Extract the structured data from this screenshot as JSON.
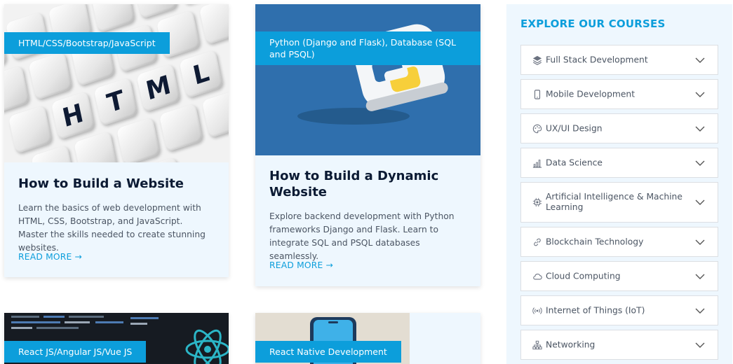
{
  "cards": [
    {
      "tag": "HTML/CSS/Bootstrap/JavaScript",
      "title": "How to Build a Website",
      "description": "Learn the basics of web development with HTML, CSS, Bootstrap, and JavaScript. Master the skills needed to create stunning websites.",
      "more": "READ MORE →",
      "keyboard_letters": [
        "H",
        "T",
        "M",
        "L"
      ]
    },
    {
      "tag": "Python (Django and Flask), Database (SQL and PSQL)",
      "title": "How to Build a Dynamic Website",
      "description": "Explore backend development with Python frameworks Django and Flask. Learn to integrate SQL and PSQL databases seamlessly.",
      "more": "READ MORE →"
    },
    {
      "tag": "React JS/Angular JS/Vue JS"
    },
    {
      "tag": "React Native Development"
    }
  ],
  "sidebar": {
    "title": "EXPLORE OUR COURSES",
    "items": [
      {
        "label": "Full Stack Development",
        "icon": "layers-icon"
      },
      {
        "label": "Mobile Development",
        "icon": "mobile-icon"
      },
      {
        "label": "UX/UI Design",
        "icon": "palette-icon"
      },
      {
        "label": "Data Science",
        "icon": "bar-chart-icon"
      },
      {
        "label": "Artificial Intelligence & Machine Learning",
        "icon": "chip-icon"
      },
      {
        "label": "Blockchain Technology",
        "icon": "link-icon"
      },
      {
        "label": "Cloud Computing",
        "icon": "cloud-icon"
      },
      {
        "label": "Internet of Things (IoT)",
        "icon": "broadcast-icon"
      },
      {
        "label": "Networking",
        "icon": "network-icon"
      }
    ]
  },
  "colors": {
    "accent": "#0c9edb",
    "card_bg": "#eef7fe",
    "heading": "#0b1a33",
    "python_blue": "#2f6fad"
  }
}
